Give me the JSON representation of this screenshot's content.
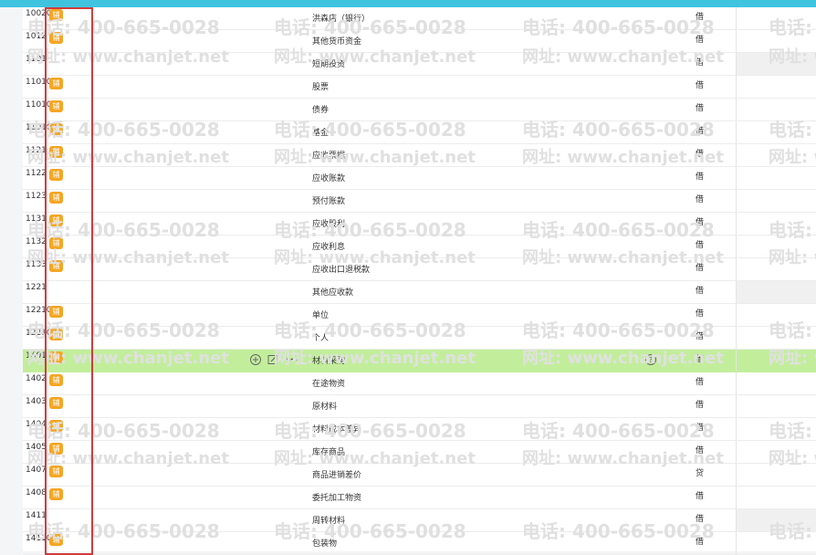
{
  "watermark": {
    "phone": "电话: 400-665-0028",
    "site": "网址: www.chanjet.net"
  },
  "accounts": [
    {
      "code": "100203",
      "badge": "辅",
      "name": "洪森店（银行）",
      "direction": "借",
      "shade": false
    },
    {
      "code": "1012",
      "badge": "辅",
      "name": "其他货币资金",
      "direction": "借",
      "shade": false
    },
    {
      "code": "1101",
      "badge": "",
      "name": "短期投资",
      "direction": "借",
      "shade": true
    },
    {
      "code": "110101",
      "badge": "辅",
      "name": "股票",
      "direction": "借",
      "shade": false
    },
    {
      "code": "110102",
      "badge": "辅",
      "name": "债券",
      "direction": "借",
      "shade": false
    },
    {
      "code": "110103",
      "badge": "辅",
      "name": "基金",
      "direction": "借",
      "shade": false
    },
    {
      "code": "1121",
      "badge": "辅",
      "name": "应收票据",
      "direction": "借",
      "shade": false
    },
    {
      "code": "1122",
      "badge": "辅",
      "name": "应收账款",
      "direction": "借",
      "shade": false
    },
    {
      "code": "1123",
      "badge": "辅",
      "name": "预付账款",
      "direction": "借",
      "shade": false
    },
    {
      "code": "1131",
      "badge": "辅",
      "name": "应收股利",
      "direction": "借",
      "shade": false
    },
    {
      "code": "1132",
      "badge": "辅",
      "name": "应收利息",
      "direction": "借",
      "shade": false
    },
    {
      "code": "1133",
      "badge": "辅",
      "name": "应收出口退税款",
      "direction": "借",
      "shade": false
    },
    {
      "code": "1221",
      "badge": "",
      "name": "其他应收款",
      "direction": "借",
      "shade": true
    },
    {
      "code": "122101",
      "badge": "辅",
      "name": "单位",
      "direction": "借",
      "shade": false
    },
    {
      "code": "122102",
      "badge": "辅",
      "name": "个人",
      "direction": "借",
      "shade": false
    },
    {
      "code": "1401",
      "badge": "辅",
      "name": "材料采购",
      "direction": "借",
      "shade": false,
      "active": true
    },
    {
      "code": "1402",
      "badge": "辅",
      "name": "在途物资",
      "direction": "借",
      "shade": false
    },
    {
      "code": "1403",
      "badge": "辅",
      "name": "原材料",
      "direction": "借",
      "shade": false
    },
    {
      "code": "1404",
      "badge": "辅",
      "name": "材料成本差异",
      "direction": "借",
      "shade": false
    },
    {
      "code": "1405",
      "badge": "辅",
      "name": "库存商品",
      "direction": "借",
      "shade": false
    },
    {
      "code": "1407",
      "badge": "辅",
      "name": "商品进销差价",
      "direction": "贷",
      "shade": false
    },
    {
      "code": "1408",
      "badge": "辅",
      "name": "委托加工物资",
      "direction": "借",
      "shade": false
    },
    {
      "code": "1411",
      "badge": "",
      "name": "周转材料",
      "direction": "借",
      "shade": true
    },
    {
      "code": "141101",
      "badge": "辅",
      "name": "包装物",
      "direction": "借",
      "shade": false
    }
  ],
  "icons": {
    "add": "plus-circle-icon",
    "edit": "edit-icon",
    "more": "more-icon",
    "help": "help-circle-icon"
  },
  "colors": {
    "topbar": "#3fc3df",
    "active_row": "#c2ee9c",
    "badge": "#f5a623",
    "frame": "#d23b3b"
  }
}
